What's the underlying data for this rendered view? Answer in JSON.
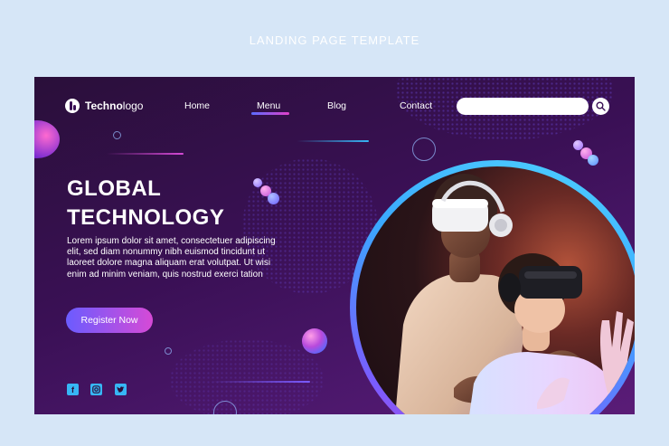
{
  "caption": "LANDING PAGE TEMPLATE",
  "logo": {
    "bold": "Techno",
    "light": "logo"
  },
  "nav": {
    "home": "Home",
    "menu": "Menu",
    "blog": "Blog",
    "contact": "Contact",
    "active": "Menu"
  },
  "search": {
    "placeholder": "",
    "value": ""
  },
  "hero": {
    "title_line1": "GLOBAL",
    "title_line2": "TECHNOLOGY",
    "body": "Lorem ipsum dolor sit amet, consectetuer adipiscing elit, sed diam nonummy nibh euismod tincidunt ut laoreet dolore magna aliquam erat volutpat. Ut wisi enim ad minim veniam, quis nostrud exerci tation",
    "cta": "Register Now"
  },
  "social": [
    "facebook-icon",
    "instagram-icon",
    "twitter-icon"
  ],
  "colors": {
    "background": "#d6e6f7",
    "card": "#3a1055",
    "accent_blue": "#37b6f5",
    "accent_pink": "#d64ad6",
    "accent_violet": "#6b5cff"
  }
}
